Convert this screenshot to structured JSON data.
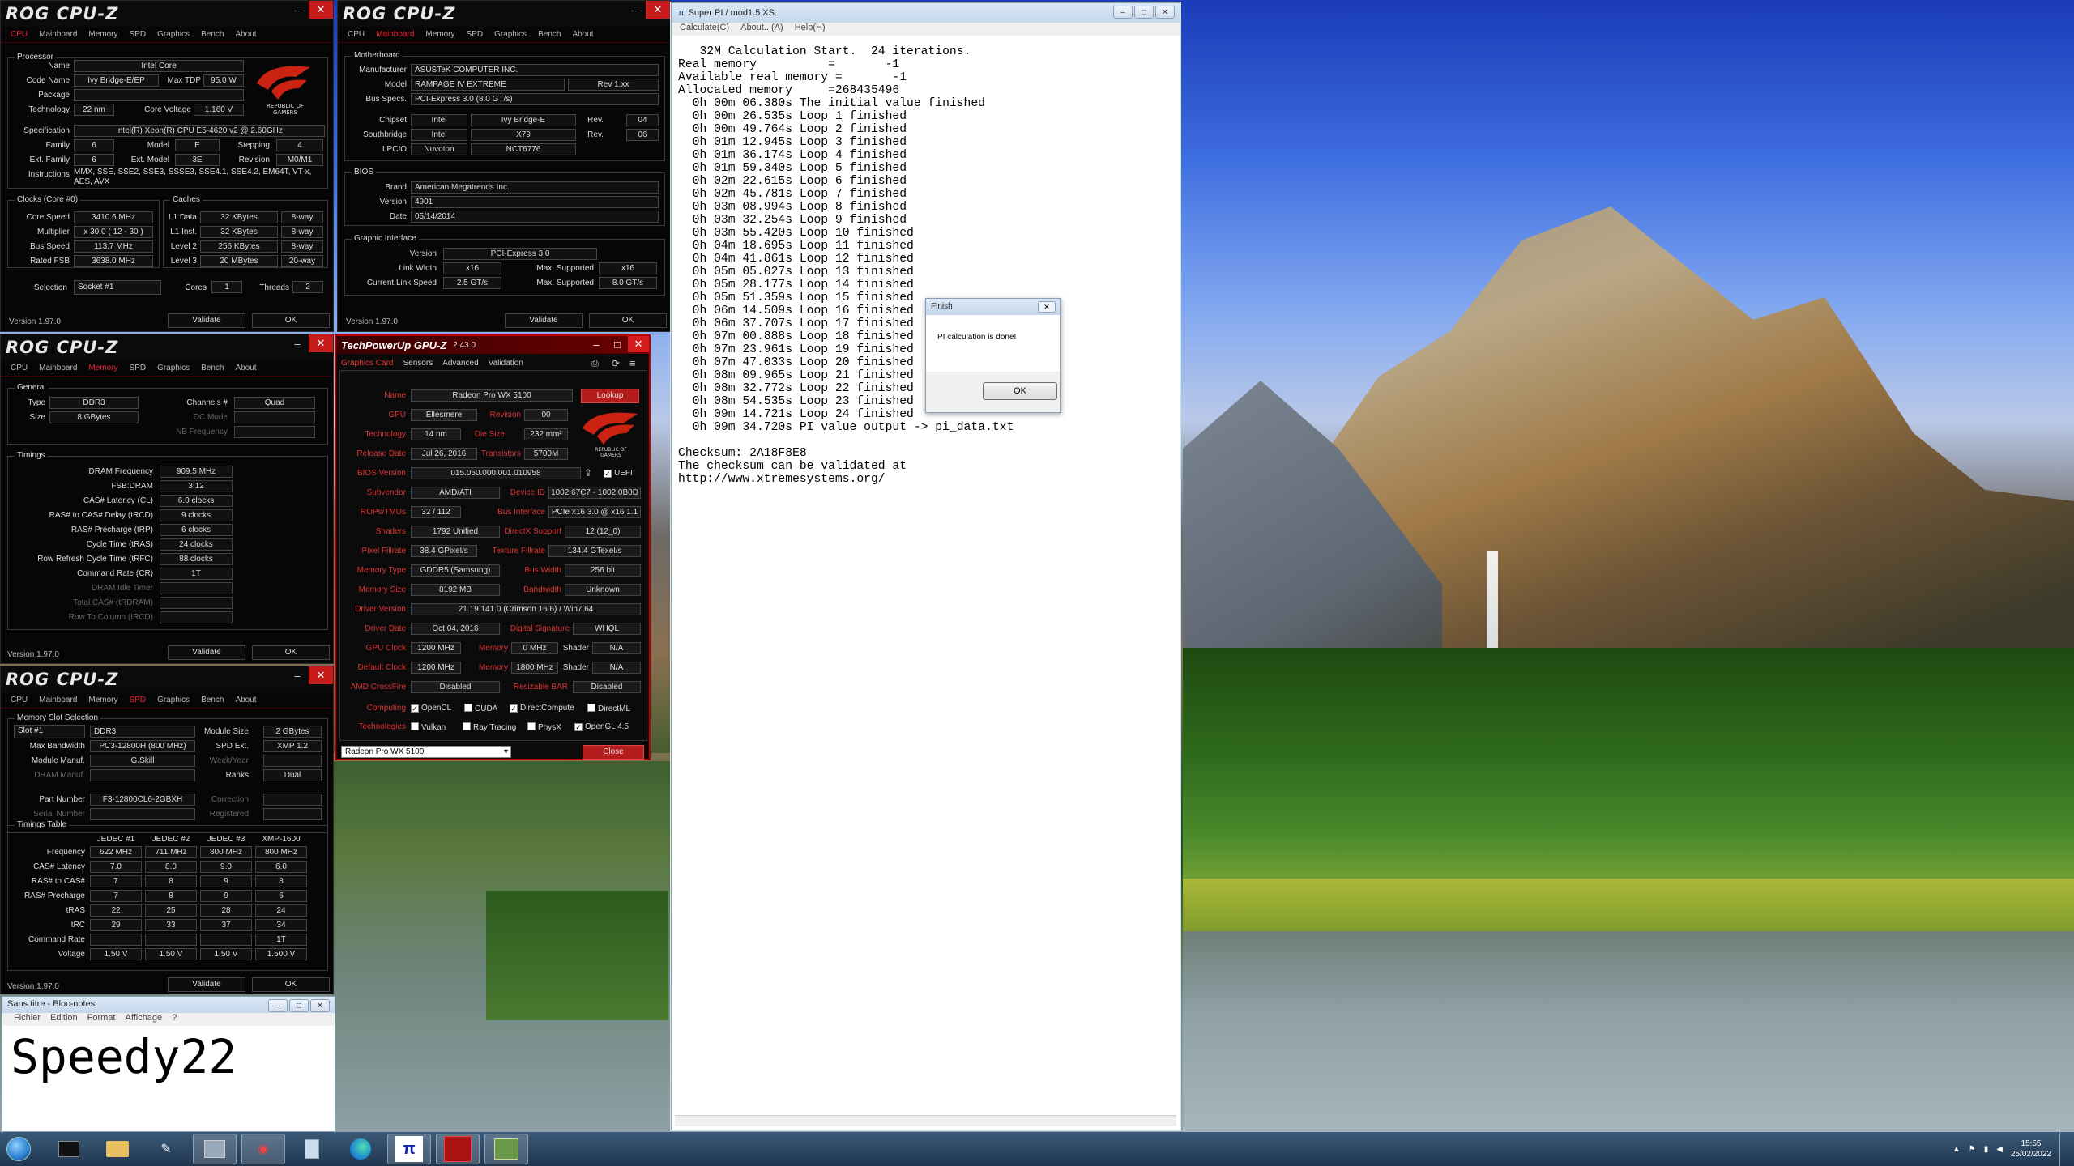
{
  "cpuz_cpu": {
    "title": "ROG CPU-Z",
    "tabs": [
      "CPU",
      "Mainboard",
      "Memory",
      "SPD",
      "Graphics",
      "Bench",
      "About"
    ],
    "processor_group": "Processor",
    "name_lbl": "Name",
    "name": "Intel Core",
    "codename_lbl": "Code Name",
    "codename": "Ivy Bridge-E/EP",
    "maxtdp_lbl": "Max TDP",
    "maxtdp": "95.0 W",
    "package_lbl": "Package",
    "package": "",
    "tech_lbl": "Technology",
    "tech": "22 nm",
    "corev_lbl": "Core Voltage",
    "corev": "1.160 V",
    "spec_lbl": "Specification",
    "spec": "Intel(R) Xeon(R) CPU E5-4620 v2 @ 2.60GHz",
    "family_lbl": "Family",
    "family": "6",
    "model_lbl": "Model",
    "model": "E",
    "stepping_lbl": "Stepping",
    "stepping": "4",
    "extfam_lbl": "Ext. Family",
    "extfam": "6",
    "extmodel_lbl": "Ext. Model",
    "extmodel": "3E",
    "revision_lbl": "Revision",
    "revision": "M0/M1",
    "instr_lbl": "Instructions",
    "instr": "MMX, SSE, SSE2, SSE3, SSSE3, SSE4.1, SSE4.2, EM64T, VT-x, AES, AVX",
    "clocks_group": "Clocks (Core #0)",
    "corespeed_lbl": "Core Speed",
    "corespeed": "3410.6 MHz",
    "mult_lbl": "Multiplier",
    "mult": "x 30.0 ( 12 - 30 )",
    "busspeed_lbl": "Bus Speed",
    "busspeed": "113.7 MHz",
    "ratedfsb_lbl": "Rated FSB",
    "ratedfsb": "3638.0 MHz",
    "caches_group": "Caches",
    "l1d_lbl": "L1 Data",
    "l1d": "32 KBytes",
    "l1d_way": "8-way",
    "l1i_lbl": "L1 Inst.",
    "l1i": "32 KBytes",
    "l1i_way": "8-way",
    "l2_lbl": "Level 2",
    "l2": "256 KBytes",
    "l2_way": "8-way",
    "l3_lbl": "Level 3",
    "l3": "20 MBytes",
    "l3_way": "20-way",
    "sel_lbl": "Selection",
    "sel": "Socket #1",
    "cores_lbl": "Cores",
    "cores": "1",
    "threads_lbl": "Threads",
    "threads": "2",
    "version": "Version 1.97.0",
    "validate": "Validate",
    "ok": "OK"
  },
  "cpuz_mb": {
    "title": "ROG CPU-Z",
    "tabs": [
      "CPU",
      "Mainboard",
      "Memory",
      "SPD",
      "Graphics",
      "Bench",
      "About"
    ],
    "mb_group": "Motherboard",
    "manuf_lbl": "Manufacturer",
    "manuf": "ASUSTeK COMPUTER INC.",
    "model_lbl": "Model",
    "model": "RAMPAGE IV EXTREME",
    "model_rev": "Rev 1.xx",
    "busspecs_lbl": "Bus Specs.",
    "busspecs": "PCI-Express 3.0 (8.0 GT/s)",
    "chipset_lbl": "Chipset",
    "chipset": "Intel",
    "chipset_name": "Ivy Bridge-E",
    "rev_lbl": "Rev.",
    "chipset_rev": "04",
    "south_lbl": "Southbridge",
    "south": "Intel",
    "south_name": "X79",
    "south_rev": "06",
    "lpcio_lbl": "LPCIO",
    "lpcio": "Nuvoton",
    "lpcio_name": "NCT6776",
    "bios_group": "BIOS",
    "brand_lbl": "Brand",
    "brand": "American Megatrends Inc.",
    "ver_lbl": "Version",
    "ver": "4901",
    "date_lbl": "Date",
    "date": "05/14/2014",
    "gi_group": "Graphic Interface",
    "giver_lbl": "Version",
    "giver": "PCI-Express 3.0",
    "lw_lbl": "Link Width",
    "lw": "x16",
    "maxsup_lbl": "Max. Supported",
    "lw_max": "x16",
    "cls_lbl": "Current Link Speed",
    "cls": "2.5 GT/s",
    "cls_max": "8.0 GT/s",
    "version": "Version 1.97.0",
    "validate": "Validate",
    "ok": "OK"
  },
  "cpuz_mem": {
    "title": "ROG CPU-Z",
    "tabs": [
      "CPU",
      "Mainboard",
      "Memory",
      "SPD",
      "Graphics",
      "Bench",
      "About"
    ],
    "gen_group": "General",
    "type_lbl": "Type",
    "type": "DDR3",
    "ch_lbl": "Channels #",
    "ch": "Quad",
    "size_lbl": "Size",
    "size": "8 GBytes",
    "dc_lbl": "DC Mode",
    "nb_lbl": "NB Frequency",
    "tim_group": "Timings",
    "rows": [
      [
        "DRAM Frequency",
        "909.5 MHz"
      ],
      [
        "FSB:DRAM",
        "3:12"
      ],
      [
        "CAS# Latency (CL)",
        "6.0 clocks"
      ],
      [
        "RAS# to CAS# Delay (tRCD)",
        "9 clocks"
      ],
      [
        "RAS# Precharge (tRP)",
        "6 clocks"
      ],
      [
        "Cycle Time (tRAS)",
        "24 clocks"
      ],
      [
        "Row Refresh Cycle Time (tRFC)",
        "88 clocks"
      ],
      [
        "Command Rate (CR)",
        "1T"
      ],
      [
        "DRAM Idle Timer",
        ""
      ],
      [
        "Total CAS# (tRDRAM)",
        ""
      ],
      [
        "Row To Column (tRCD)",
        ""
      ]
    ],
    "version": "Version 1.97.0",
    "validate": "Validate",
    "ok": "OK"
  },
  "cpuz_spd": {
    "title": "ROG CPU-Z",
    "tabs": [
      "CPU",
      "Mainboard",
      "Memory",
      "SPD",
      "Graphics",
      "Bench",
      "About"
    ],
    "slot_group": "Memory Slot Selection",
    "slot": "Slot #1",
    "slot_type": "DDR3",
    "modsize_lbl": "Module Size",
    "modsize": "2 GBytes",
    "maxbw_lbl": "Max Bandwidth",
    "maxbw": "PC3-12800H (800 MHz)",
    "spdext_lbl": "SPD Ext.",
    "spdext": "XMP 1.2",
    "manuf_lbl": "Module Manuf.",
    "manuf": "G.Skill",
    "wy_lbl": "Week/Year",
    "drammanuf_lbl": "DRAM Manuf.",
    "ranks_lbl": "Ranks",
    "ranks": "Dual",
    "pn_lbl": "Part Number",
    "pn": "F3-12800CL6-2GBXH",
    "corr_lbl": "Correction",
    "sn_lbl": "Serial Number",
    "reg_lbl": "Registered",
    "tt_group": "Timings Table",
    "cols": [
      "JEDEC #1",
      "JEDEC #2",
      "JEDEC #3",
      "XMP-1600"
    ],
    "rows": [
      [
        "Frequency",
        "622 MHz",
        "711 MHz",
        "800 MHz",
        "800 MHz"
      ],
      [
        "CAS# Latency",
        "7.0",
        "8.0",
        "9.0",
        "6.0"
      ],
      [
        "RAS# to CAS#",
        "7",
        "8",
        "9",
        "8"
      ],
      [
        "RAS# Precharge",
        "7",
        "8",
        "9",
        "6"
      ],
      [
        "tRAS",
        "22",
        "25",
        "28",
        "24"
      ],
      [
        "tRC",
        "29",
        "33",
        "37",
        "34"
      ],
      [
        "Command Rate",
        "",
        "",
        "",
        "1T"
      ],
      [
        "Voltage",
        "1.50 V",
        "1.50 V",
        "1.50 V",
        "1.500 V"
      ]
    ],
    "version": "Version 1.97.0",
    "validate": "Validate",
    "ok": "OK"
  },
  "gpuz": {
    "title": "TechPowerUp GPU-Z",
    "version": "2.43.0",
    "tabs": [
      "Graphics Card",
      "Sensors",
      "Advanced",
      "Validation"
    ],
    "name_lbl": "Name",
    "name": "Radeon Pro WX 5100",
    "lookup": "Lookup",
    "gpu_lbl": "GPU",
    "gpu": "Ellesmere",
    "rev_lbl": "Revision",
    "rev": "00",
    "tech_lbl": "Technology",
    "tech": "14 nm",
    "die_lbl": "Die Size",
    "die": "232 mm²",
    "rel_lbl": "Release Date",
    "rel": "Jul 26, 2016",
    "trans_lbl": "Transistors",
    "trans": "5700M",
    "bios_lbl": "BIOS Version",
    "bios": "015.050.000.001.010958",
    "uefi": "UEFI",
    "sub_lbl": "Subvendor",
    "sub": "AMD/ATI",
    "devid_lbl": "Device ID",
    "devid": "1002 67C7 - 1002 0B0D",
    "rops_lbl": "ROPs/TMUs",
    "rops": "32 / 112",
    "busif_lbl": "Bus Interface",
    "busif": "PCIe x16 3.0 @ x16 1.1",
    "shaders_lbl": "Shaders",
    "shaders": "1792 Unified",
    "dx_lbl": "DirectX Support",
    "dx": "12 (12_0)",
    "pf_lbl": "Pixel Fillrate",
    "pf": "38.4 GPixel/s",
    "tf_lbl": "Texture Fillrate",
    "tf": "134.4 GTexel/s",
    "mt_lbl": "Memory Type",
    "mt": "GDDR5 (Samsung)",
    "bw_lbl": "Bus Width",
    "bw": "256 bit",
    "ms_lbl": "Memory Size",
    "ms": "8192 MB",
    "band_lbl": "Bandwidth",
    "band": "Unknown",
    "drv_lbl": "Driver Version",
    "drv": "21.19.141.0 (Crimson 16.6) / Win7 64",
    "dd_lbl": "Driver Date",
    "dd": "Oct 04, 2016",
    "ds_lbl": "Digital Signature",
    "ds": "WHQL",
    "gc_lbl": "GPU Clock",
    "gc": "1200 MHz",
    "mem_lbl": "Memory",
    "gcm": "0 MHz",
    "shader_lbl": "Shader",
    "gcs": "N/A",
    "dc_lbl": "Default Clock",
    "dc": "1200 MHz",
    "dcm": "1800 MHz",
    "dcs": "N/A",
    "cf_lbl": "AMD CrossFire",
    "cf": "Disabled",
    "rb_lbl": "Resizable BAR",
    "rb": "Disabled",
    "comp_lbl": "Computing",
    "c1": "OpenCL",
    "c2": "CUDA",
    "c3": "DirectCompute",
    "c4": "DirectML",
    "tech2_lbl": "Technologies",
    "t1": "Vulkan",
    "t2": "Ray Tracing",
    "t3": "PhysX",
    "t4": "OpenGL 4.5",
    "card_select": "Radeon Pro WX 5100",
    "close": "Close"
  },
  "superpi": {
    "title": "Super PI / mod1.5 XS",
    "menu": [
      "Calculate(C)",
      "About...(A)",
      "Help(H)"
    ],
    "output": "   32M Calculation Start.  24 iterations.\nReal memory          =       -1\nAvailable real memory =       -1\nAllocated memory     =268435496\n  0h 00m 06.380s The initial value finished\n  0h 00m 26.535s Loop 1 finished\n  0h 00m 49.764s Loop 2 finished\n  0h 01m 12.945s Loop 3 finished\n  0h 01m 36.174s Loop 4 finished\n  0h 01m 59.340s Loop 5 finished\n  0h 02m 22.615s Loop 6 finished\n  0h 02m 45.781s Loop 7 finished\n  0h 03m 08.994s Loop 8 finished\n  0h 03m 32.254s Loop 9 finished\n  0h 03m 55.420s Loop 10 finished\n  0h 04m 18.695s Loop 11 finished\n  0h 04m 41.861s Loop 12 finished\n  0h 05m 05.027s Loop 13 finished\n  0h 05m 28.177s Loop 14 finished\n  0h 05m 51.359s Loop 15 finished\n  0h 06m 14.509s Loop 16 finished\n  0h 06m 37.707s Loop 17 finished\n  0h 07m 00.888s Loop 18 finished\n  0h 07m 23.961s Loop 19 finished\n  0h 07m 47.033s Loop 20 finished\n  0h 08m 09.965s Loop 21 finished\n  0h 08m 32.772s Loop 22 finished\n  0h 08m 54.535s Loop 23 finished\n  0h 09m 14.721s Loop 24 finished\n  0h 09m 34.720s PI value output -> pi_data.txt\n\nChecksum: 2A18F8E8\nThe checksum can be validated at\nhttp://www.xtremesystems.org/"
  },
  "dialog": {
    "title": "Finish",
    "message": "PI calculation is done!",
    "ok": "OK"
  },
  "notepad": {
    "title": "Sans titre - Bloc-notes",
    "menu": [
      "Fichier",
      "Edition",
      "Format",
      "Affichage",
      "?"
    ],
    "text": "Speedy22"
  },
  "taskbar": {
    "time": "15:55",
    "date": "25/02/2022",
    "items": [
      "cmd",
      "explorer",
      "tool",
      "cpuid",
      "rog-tool",
      "calc",
      "edge",
      "superpi",
      "rog-cpuz",
      "app"
    ]
  }
}
